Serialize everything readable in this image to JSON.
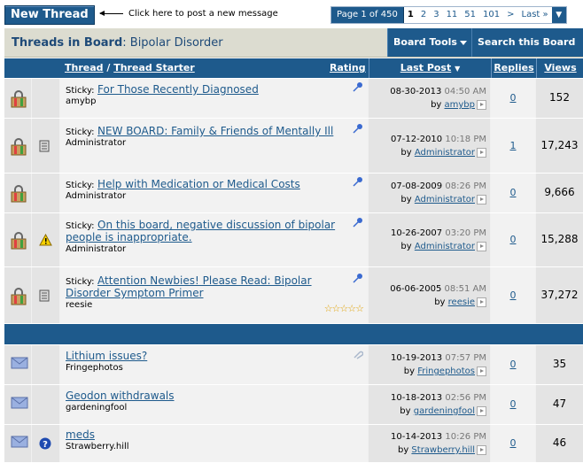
{
  "toolbar": {
    "new_thread_label": "New Thread",
    "hint": "Click here to post a new message"
  },
  "pager": {
    "label": "Page 1 of 450",
    "pages": [
      "1",
      "2",
      "3",
      "11",
      "51",
      "101",
      ">",
      "Last »"
    ],
    "current": "1"
  },
  "board": {
    "title_prefix": "Threads in Board",
    "title_name": ": Bipolar Disorder",
    "tools_label": "Board Tools",
    "search_label": "Search this Board"
  },
  "columns": {
    "thread": "Thread",
    "slash": " / ",
    "starter": "Thread Starter",
    "rating": "Rating",
    "last_post": "Last Post",
    "replies": "Replies",
    "views": "Views"
  },
  "sticky_label": "Sticky:",
  "sticky_threads": [
    {
      "title": "For Those Recently Diagnosed",
      "starter": "amybp",
      "date": "08-30-2013",
      "time": "04:50 AM",
      "by": "by",
      "last_poster": "amybp",
      "replies": "0",
      "views": "152",
      "icon2": ""
    },
    {
      "title": "NEW BOARD: Family & Friends of Mentally Ill",
      "starter": "Administrator",
      "date": "07-12-2010",
      "time": "10:18 PM",
      "by": "by",
      "last_poster": "Administrator",
      "replies": "1",
      "views": "17,243",
      "icon2": "note-icon"
    },
    {
      "title": "Help with Medication or Medical Costs",
      "starter": "Administrator",
      "date": "07-08-2009",
      "time": "08:26 PM",
      "by": "by",
      "last_poster": "Administrator",
      "replies": "0",
      "views": "9,666",
      "icon2": ""
    },
    {
      "title": "On this board, negative discussion of bipolar people is inappropriate.",
      "starter": "Administrator",
      "date": "10-26-2007",
      "time": "03:20 PM",
      "by": "by",
      "last_poster": "Administrator",
      "replies": "0",
      "views": "15,288",
      "icon2": "warning-icon"
    },
    {
      "title": "Attention Newbies! Please Read: Bipolar Disorder Symptom Primer",
      "starter": "reesie",
      "date": "06-06-2005",
      "time": "08:51 AM",
      "by": "by",
      "last_poster": "reesie",
      "replies": "0",
      "views": "37,272",
      "icon2": "note-icon",
      "rating": "☆☆☆☆☆"
    }
  ],
  "normal_threads": [
    {
      "title": "Lithium issues?",
      "starter": "Fringephotos",
      "date": "10-19-2013",
      "time": "07:57 PM",
      "by": "by",
      "last_poster": "Fringephotos",
      "replies": "0",
      "views": "35",
      "icon2": "",
      "attachment": true
    },
    {
      "title": "Geodon withdrawals",
      "starter": "gardeningfool",
      "date": "10-18-2013",
      "time": "02:56 PM",
      "by": "by",
      "last_poster": "gardeningfool",
      "replies": "0",
      "views": "47",
      "icon2": ""
    },
    {
      "title": "meds",
      "starter": "Strawberry.hill",
      "date": "10-14-2013",
      "time": "10:26 PM",
      "by": "by",
      "last_poster": "Strawberry.hill",
      "replies": "0",
      "views": "46",
      "icon2": "question-icon"
    }
  ],
  "colors": {
    "brand": "#1e5a8c",
    "band": "#dcdcd0"
  }
}
